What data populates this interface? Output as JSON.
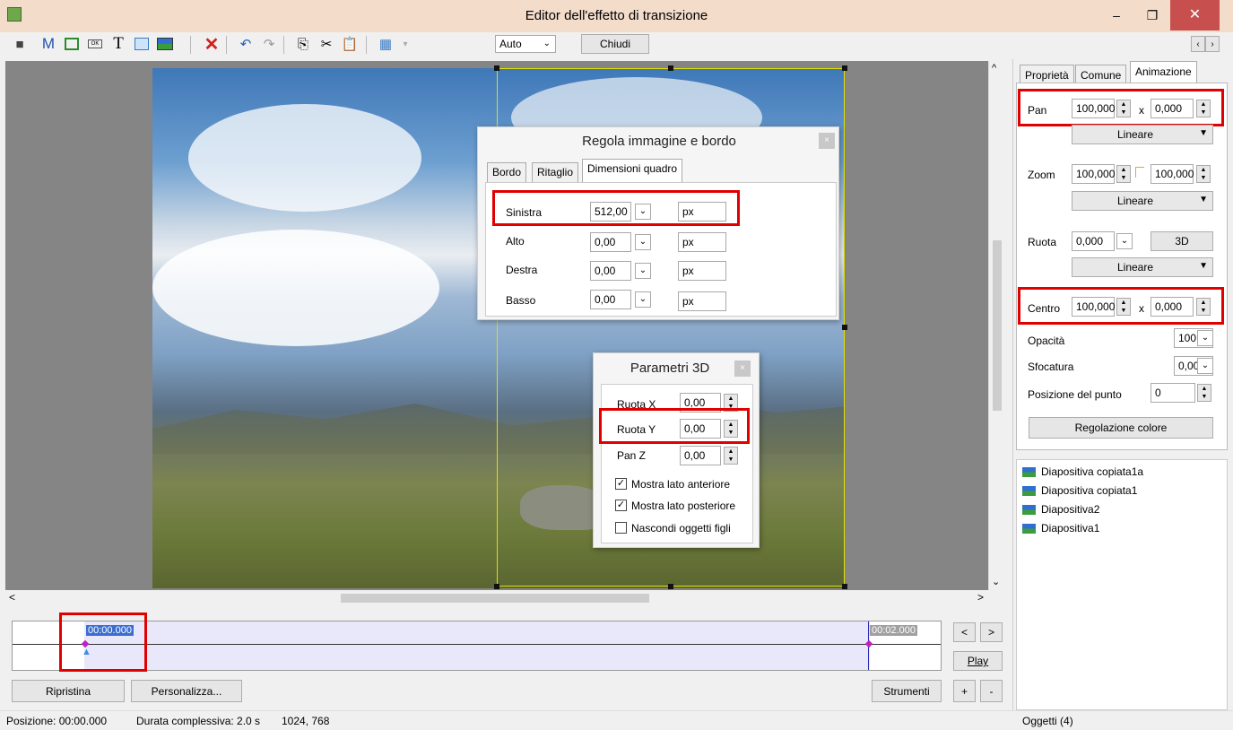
{
  "window": {
    "title": "Editor dell'effetto di transizione",
    "minimize": "–",
    "maximize": "❐",
    "close": "✕"
  },
  "toolbar": {
    "mode_label": "M",
    "text_tool": "T",
    "zoom_select": "Auto",
    "close_button": "Chiudi",
    "nav_prev": "‹",
    "nav_next": "›"
  },
  "dialog_image": {
    "title": "Regola immagine e bordo",
    "close": "×",
    "tabs": [
      "Bordo",
      "Ritaglio",
      "Dimensioni quadro"
    ],
    "rows": [
      {
        "label": "Sinistra",
        "value": "512,00",
        "unit": "px"
      },
      {
        "label": "Alto",
        "value": "0,00",
        "unit": "px"
      },
      {
        "label": "Destra",
        "value": "0,00",
        "unit": "px"
      },
      {
        "label": "Basso",
        "value": "0,00",
        "unit": "px"
      }
    ]
  },
  "dialog_3d": {
    "title": "Parametri 3D",
    "close": "×",
    "rows": [
      {
        "label": "Ruota X",
        "value": "0,00"
      },
      {
        "label": "Ruota Y",
        "value": "0,00"
      },
      {
        "label": "Pan Z",
        "value": "0,00"
      }
    ],
    "checks": [
      {
        "label": "Mostra lato anteriore",
        "checked": true
      },
      {
        "label": "Mostra lato posteriore",
        "checked": true
      },
      {
        "label": "Nascondi oggetti figli",
        "checked": false
      }
    ]
  },
  "timeline": {
    "start_time": "00:00.000",
    "end_time": "00:02.000",
    "prev": "<",
    "next": ">",
    "play": "Play"
  },
  "bottom_buttons": {
    "reset": "Ripristina",
    "customize": "Personalizza...",
    "tools": "Strumenti",
    "plus": "+",
    "minus": "-"
  },
  "right_panel": {
    "tabs": [
      "Proprietà",
      "Comune",
      "Animazione"
    ],
    "pan": {
      "label": "Pan",
      "x": "100,000",
      "sep": "x",
      "y": "0,000",
      "mode": "Lineare"
    },
    "zoom": {
      "label": "Zoom",
      "x": "100,000",
      "y": "100,000",
      "mode": "Lineare"
    },
    "rotate": {
      "label": "Ruota",
      "value": "0,000",
      "button_3d": "3D",
      "mode": "Lineare"
    },
    "center": {
      "label": "Centro",
      "x": "100,000",
      "sep": "x",
      "y": "0,000"
    },
    "opacity": {
      "label": "Opacità",
      "value": "100,0"
    },
    "blur": {
      "label": "Sfocatura",
      "value": "0,00"
    },
    "point_pos": {
      "label": "Posizione del punto",
      "value": "0"
    },
    "color_button": "Regolazione colore",
    "objects": [
      "Diapositiva copiata1a",
      "Diapositiva copiata1",
      "Diapositiva2",
      "Diapositiva1"
    ]
  },
  "status": {
    "position": "Posizione: 00:00.000",
    "duration": "Durata complessiva: 2.0 s",
    "size": "1024, 768",
    "objects": "Oggetti (4)"
  }
}
